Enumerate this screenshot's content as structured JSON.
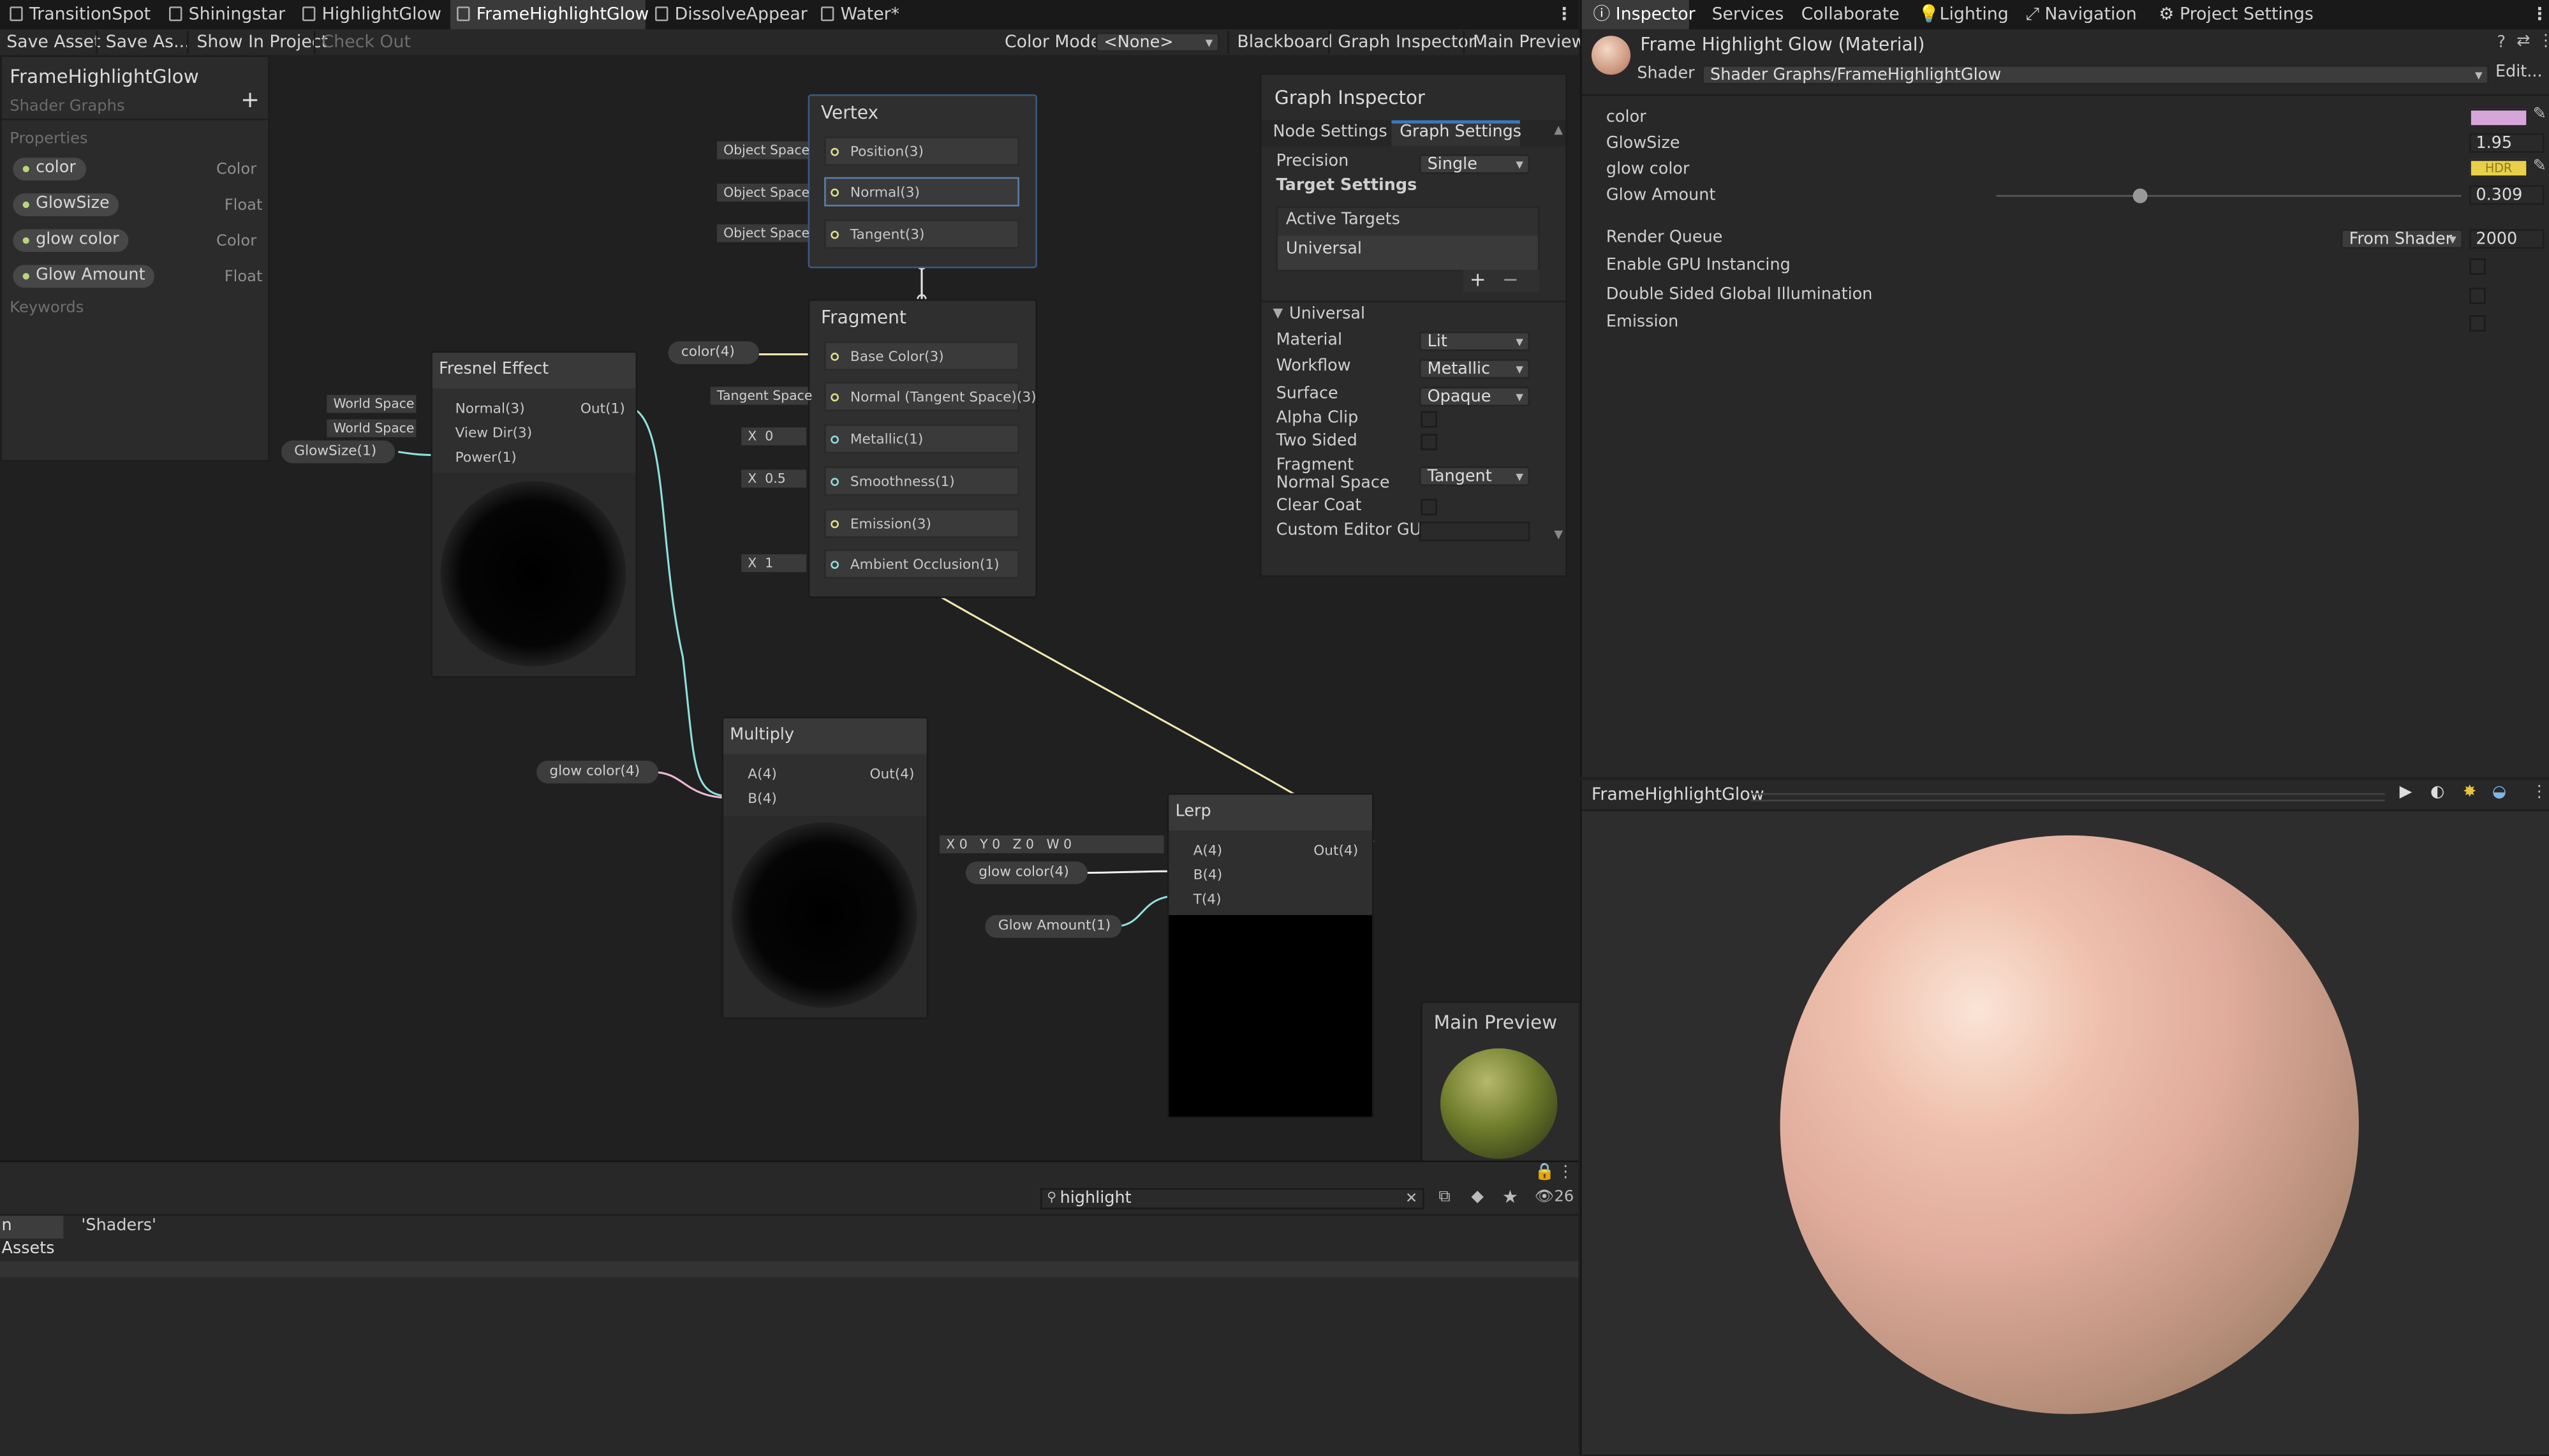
{
  "tabs": [
    "TransitionSpot",
    "Shiningstar",
    "HighlightGlow",
    "FrameHighlightGlow",
    "DissolveAppear",
    "Water*"
  ],
  "toolbar": {
    "save_asset": "Save Asset",
    "save_as": "Save As...",
    "show_in_project": "Show In Project",
    "check_out": "Check Out",
    "color_mode_label": "Color Mode",
    "color_mode_value": "<None>",
    "blackboard": "Blackboard",
    "graph_inspector": "Graph Inspector",
    "main_preview": "Main Preview"
  },
  "blackboard": {
    "title": "FrameHighlightGlow",
    "subtitle": "Shader Graphs",
    "add": "+",
    "properties_label": "Properties",
    "keywords_label": "Keywords",
    "properties": [
      {
        "name": "color",
        "type": "Color"
      },
      {
        "name": "GlowSize",
        "type": "Float"
      },
      {
        "name": "glow color",
        "type": "Color"
      },
      {
        "name": "Glow Amount",
        "type": "Float"
      }
    ]
  },
  "vertex": {
    "title": "Vertex",
    "ports": [
      {
        "label": "Position(3)",
        "input": "Object Space"
      },
      {
        "label": "Normal(3)",
        "input": "Object Space"
      },
      {
        "label": "Tangent(3)",
        "input": "Object Space"
      }
    ]
  },
  "fragment": {
    "title": "Fragment",
    "ports": [
      {
        "label": "Base Color(3)"
      },
      {
        "label": "Normal (Tangent Space)(3)"
      },
      {
        "label": "Metallic(1)"
      },
      {
        "label": "Smoothness(1)"
      },
      {
        "label": "Emission(3)"
      },
      {
        "label": "Ambient Occlusion(1)"
      }
    ],
    "color_pill": "color(4)",
    "tangent_space": "Tangent Space",
    "metallic_x": "X",
    "metallic_val": "0",
    "smooth_x": "X",
    "smooth_val": "0.5",
    "ao_x": "X",
    "ao_val": "1"
  },
  "fresnel": {
    "title": "Fresnel Effect",
    "out": "Out(1)",
    "inputs": [
      "Normal(3)",
      "View Dir(3)",
      "Power(1)"
    ],
    "world1": "World Space",
    "world2": "World Space",
    "glowsize_pill": "GlowSize(1)"
  },
  "multiply": {
    "title": "Multiply",
    "a": "A(4)",
    "b": "B(4)",
    "out": "Out(4)",
    "glow_pill": "glow color(4)"
  },
  "lerp": {
    "title": "Lerp",
    "a": "A(4)",
    "b": "B(4)",
    "t": "T(4)",
    "out": "Out(4)",
    "glow_pill": "glow color(4)",
    "amount_pill": "Glow Amount(1)",
    "vec": [
      {
        "k": "X",
        "v": "0"
      },
      {
        "k": "Y",
        "v": "0"
      },
      {
        "k": "Z",
        "v": "0"
      },
      {
        "k": "W",
        "v": "0"
      }
    ]
  },
  "graph_inspector": {
    "title": "Graph Inspector",
    "tab_node": "Node Settings",
    "tab_graph": "Graph Settings",
    "precision_label": "Precision",
    "precision_value": "Single",
    "target_settings": "Target Settings",
    "active_targets": "Active Targets",
    "universal_item": "Universal",
    "plus": "+",
    "minus": "−",
    "universal_section": "Universal",
    "material_label": "Material",
    "material_value": "Lit",
    "workflow_label": "Workflow",
    "workflow_value": "Metallic",
    "surface_label": "Surface",
    "surface_value": "Opaque",
    "alpha_clip": "Alpha Clip",
    "two_sided": "Two Sided",
    "frag_normal_label": "Fragment Normal Space",
    "frag_normal_value": "Tangent",
    "clear_coat": "Clear Coat",
    "custom_editor": "Custom Editor GUI"
  },
  "main_preview": {
    "title": "Main Preview"
  },
  "inspector": {
    "tabs": [
      "Inspector",
      "Services",
      "Collaborate",
      "Lighting",
      "Navigation",
      "Project Settings"
    ],
    "material_title": "Frame Highlight Glow (Material)",
    "shader_label": "Shader",
    "shader_value": "Shader Graphs/FrameHighlightGlow",
    "edit": "Edit...",
    "props": [
      {
        "name": "color"
      },
      {
        "name": "GlowSize",
        "value": "1.95"
      },
      {
        "name": "glow color",
        "value": "HDR"
      },
      {
        "name": "Glow Amount",
        "value": "0.309"
      }
    ],
    "glow_amount_fraction": 0.309,
    "color_swatch": "#d6a6d9",
    "glow_swatch": "#e8d04a",
    "render_queue_label": "Render Queue",
    "render_queue_mode": "From Shader",
    "render_queue_value": "2000",
    "gpu_instancing": "Enable GPU Instancing",
    "double_sided_gi": "Double Sided Global Illumination",
    "emission": "Emission"
  },
  "preview": {
    "title": "FrameHighlightGlow"
  },
  "project": {
    "search": "highlight",
    "count": "26",
    "breadcrumb_all": "n Assets",
    "breadcrumb_filter": "'Shaders'"
  }
}
